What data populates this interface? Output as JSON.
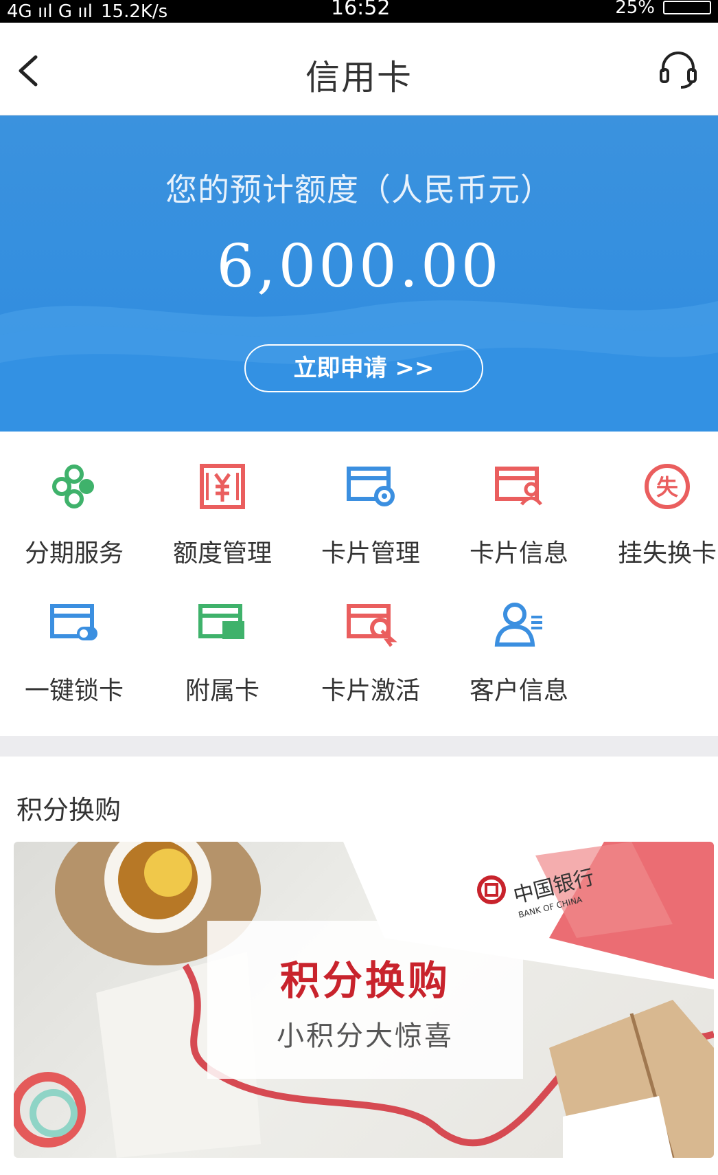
{
  "status_bar": {
    "network": "4G ııl  G ııl",
    "speed": "15.2K/s",
    "time": "16:52",
    "battery": "25%"
  },
  "nav": {
    "title": "信用卡",
    "back_icon": "chevron-left-icon",
    "service_icon": "headset-icon"
  },
  "hero": {
    "label": "您的预计额度（人民币元）",
    "amount": "6,000.00",
    "apply_button": "立即申请 >>"
  },
  "services": [
    {
      "label": "分期服务",
      "icon": "installment-icon",
      "color": "#3fb26b"
    },
    {
      "label": "额度管理",
      "icon": "credit-limit-icon",
      "color": "#ea5e5e"
    },
    {
      "label": "卡片管理",
      "icon": "card-settings-icon",
      "color": "#3b8fe0"
    },
    {
      "label": "卡片信息",
      "icon": "card-info-icon",
      "color": "#ea5e5e"
    },
    {
      "label": "挂失换卡",
      "icon": "report-loss-icon",
      "color": "#ea5e5e"
    },
    {
      "label": "一键锁卡",
      "icon": "card-lock-icon",
      "color": "#3b8fe0"
    },
    {
      "label": "附属卡",
      "icon": "supplementary-card-icon",
      "color": "#3fb26b"
    },
    {
      "label": "卡片激活",
      "icon": "card-activate-icon",
      "color": "#ea5e5e"
    },
    {
      "label": "客户信息",
      "icon": "customer-info-icon",
      "color": "#3b8fe0"
    }
  ],
  "points": {
    "section_title": "积分换购",
    "banner_title": "积分换购",
    "banner_subtitle": "小积分大惊喜",
    "bank_name_cn": "中国银行",
    "bank_name_en": "BANK OF CHINA"
  },
  "colors": {
    "hero_blue": "#2e8ce0",
    "accent_red": "#c8232c",
    "green": "#3fb26b",
    "red": "#ea5e5e",
    "blue": "#3b8fe0"
  }
}
